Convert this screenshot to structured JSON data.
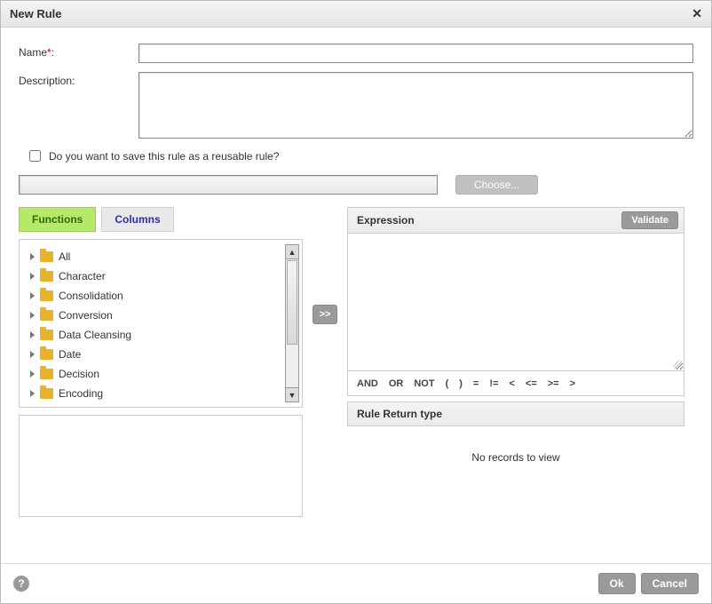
{
  "dialog": {
    "title": "New Rule",
    "name_label": "Name",
    "name_required_marker": "*",
    "name_colon": ":",
    "name_value": "",
    "description_label": "Description:",
    "description_value": "",
    "reusable_label": "Do you want to save this rule as a reusable rule?",
    "choose_value": "",
    "choose_button": "Choose..."
  },
  "tabs": {
    "functions": "Functions",
    "columns": "Columns"
  },
  "tree": {
    "items": [
      {
        "label": "All"
      },
      {
        "label": "Character"
      },
      {
        "label": "Consolidation"
      },
      {
        "label": "Conversion"
      },
      {
        "label": "Data Cleansing"
      },
      {
        "label": "Date"
      },
      {
        "label": "Decision"
      },
      {
        "label": "Encoding"
      }
    ]
  },
  "transfer": {
    "label": ">>"
  },
  "expression": {
    "header": "Expression",
    "validate": "Validate"
  },
  "operators": [
    "AND",
    "OR",
    "NOT",
    "(",
    ")",
    "=",
    "!=",
    "<",
    "<=",
    ">=",
    ">"
  ],
  "return_type": {
    "header": "Rule Return type",
    "empty": "No records to view"
  },
  "footer": {
    "help": "?",
    "ok": "Ok",
    "cancel": "Cancel"
  }
}
